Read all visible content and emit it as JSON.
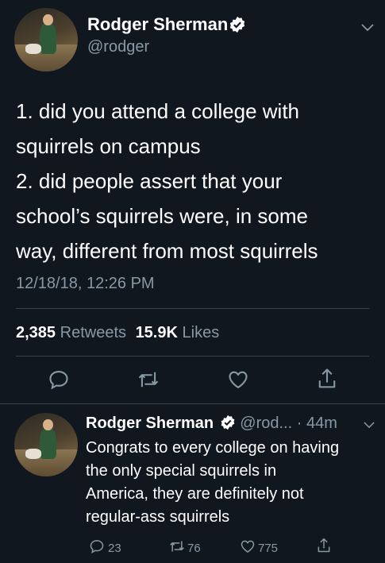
{
  "main_tweet": {
    "author_name": "Rodger Sherman",
    "handle": "@rodger",
    "text_lines": [
      "1. did you attend a college with",
      "squirrels on campus",
      "2. did people assert that your",
      "school’s squirrels were, in some",
      "way, different from most squirrels"
    ],
    "timestamp": "12/18/18, 12:26 PM",
    "retweets_count": "2,385",
    "retweets_label": "Retweets",
    "likes_count": "15.9K",
    "likes_label": "Likes"
  },
  "reply_tweet": {
    "author_name": "Rodger Sherman",
    "handle": "@rod...",
    "age": "· 44m",
    "text_lines": [
      "Congrats to every college on having",
      "the only special squirrels in",
      "America, they are definitely not",
      "regular-ass squirrels"
    ],
    "reply_count": "23",
    "retweet_count": "76",
    "like_count": "775"
  },
  "colors": {
    "background": "#10171e",
    "text": "#ffffff",
    "muted": "#8899a6",
    "divider": "#38444d",
    "verified": "#ffffff"
  }
}
